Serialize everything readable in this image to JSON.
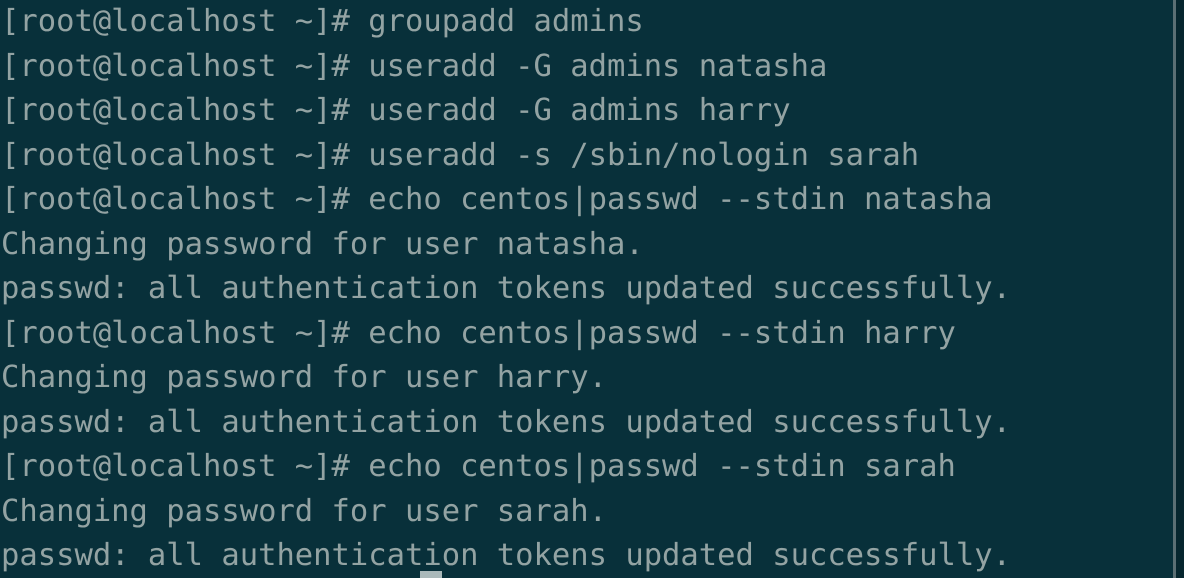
{
  "terminal": {
    "background_color": "#08303a",
    "foreground_color": "#93a3a3",
    "cursor_color": "#b9c6c6",
    "prompt": "[root@localhost ~]#",
    "lines": [
      {
        "type": "command",
        "text": "[root@localhost ~]# groupadd admins"
      },
      {
        "type": "command",
        "text": "[root@localhost ~]# useradd -G admins natasha"
      },
      {
        "type": "command",
        "text": "[root@localhost ~]# useradd -G admins harry"
      },
      {
        "type": "command",
        "text": "[root@localhost ~]# useradd -s /sbin/nologin sarah"
      },
      {
        "type": "command",
        "text": "[root@localhost ~]# echo centos|passwd --stdin natasha"
      },
      {
        "type": "output",
        "text": "Changing password for user natasha."
      },
      {
        "type": "output",
        "text": "passwd: all authentication tokens updated successfully."
      },
      {
        "type": "command",
        "text": "[root@localhost ~]# echo centos|passwd --stdin harry"
      },
      {
        "type": "output",
        "text": "Changing password for user harry."
      },
      {
        "type": "output",
        "text": "passwd: all authentication tokens updated successfully."
      },
      {
        "type": "command",
        "text": "[root@localhost ~]# echo centos|passwd --stdin sarah"
      },
      {
        "type": "output",
        "text": "Changing password for user sarah."
      },
      {
        "type": "output",
        "text": "passwd: all authentication tokens updated successfully."
      }
    ]
  }
}
